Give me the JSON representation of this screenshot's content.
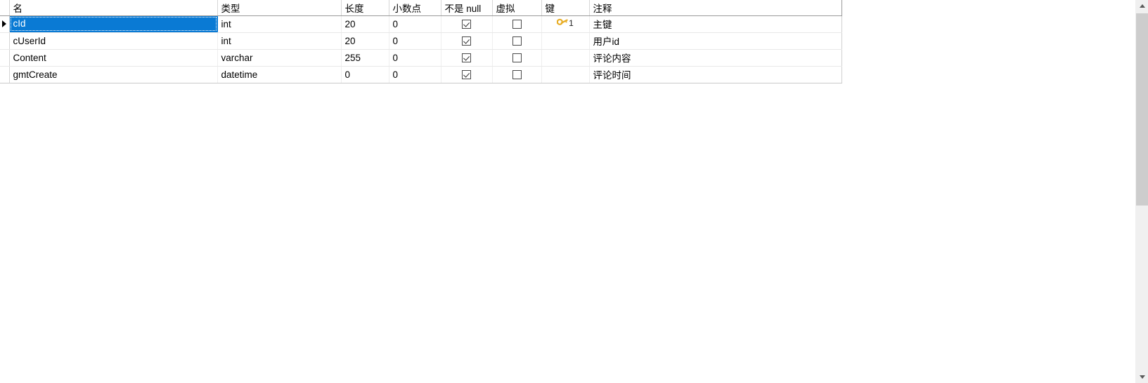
{
  "grid": {
    "columns": [
      {
        "id": "gutter",
        "label": ""
      },
      {
        "id": "name",
        "label": "名"
      },
      {
        "id": "type",
        "label": "类型"
      },
      {
        "id": "length",
        "label": "长度"
      },
      {
        "id": "decimal",
        "label": "小数点"
      },
      {
        "id": "notnull",
        "label": "不是 null"
      },
      {
        "id": "virtual",
        "label": "虚拟"
      },
      {
        "id": "key",
        "label": "键"
      },
      {
        "id": "comment",
        "label": "注释"
      }
    ],
    "rows": [
      {
        "name": "cId",
        "type": "int",
        "length": "20",
        "decimal": "0",
        "notnull": true,
        "virtual": false,
        "key": "1",
        "has_key": true,
        "comment": "主键",
        "selected": true,
        "current": true
      },
      {
        "name": "cUserId",
        "type": "int",
        "length": "20",
        "decimal": "0",
        "notnull": true,
        "virtual": false,
        "key": "",
        "has_key": false,
        "comment": "用户id",
        "selected": false,
        "current": false
      },
      {
        "name": "Content",
        "type": "varchar",
        "length": "255",
        "decimal": "0",
        "notnull": true,
        "virtual": false,
        "key": "",
        "has_key": false,
        "comment": "评论内容",
        "selected": false,
        "current": false
      },
      {
        "name": "gmtCreate",
        "type": "datetime",
        "length": "0",
        "decimal": "0",
        "notnull": true,
        "virtual": false,
        "key": "",
        "has_key": false,
        "comment": "评论时间",
        "selected": false,
        "current": false
      }
    ]
  },
  "icons": {
    "primary_key": "key-icon",
    "current_row": "triangle-right-icon",
    "checkbox_checked": "checkbox-checked-icon",
    "checkbox_unchecked": "checkbox-unchecked-icon",
    "scroll_up": "chevron-up-icon",
    "scroll_down": "chevron-down-icon"
  },
  "colors": {
    "selection": "#0a7ad4",
    "selection_text": "#ffffff",
    "key_icon": "#e8ad24",
    "header_rule": "#9a9a9a",
    "row_rule": "#e8e8e8",
    "scrollbar_thumb": "#cdcdcd",
    "scrollbar_track": "#f0f0f0"
  },
  "scrollbar": {
    "orientation": "vertical",
    "up_label": "▲",
    "down_label": "▼"
  }
}
